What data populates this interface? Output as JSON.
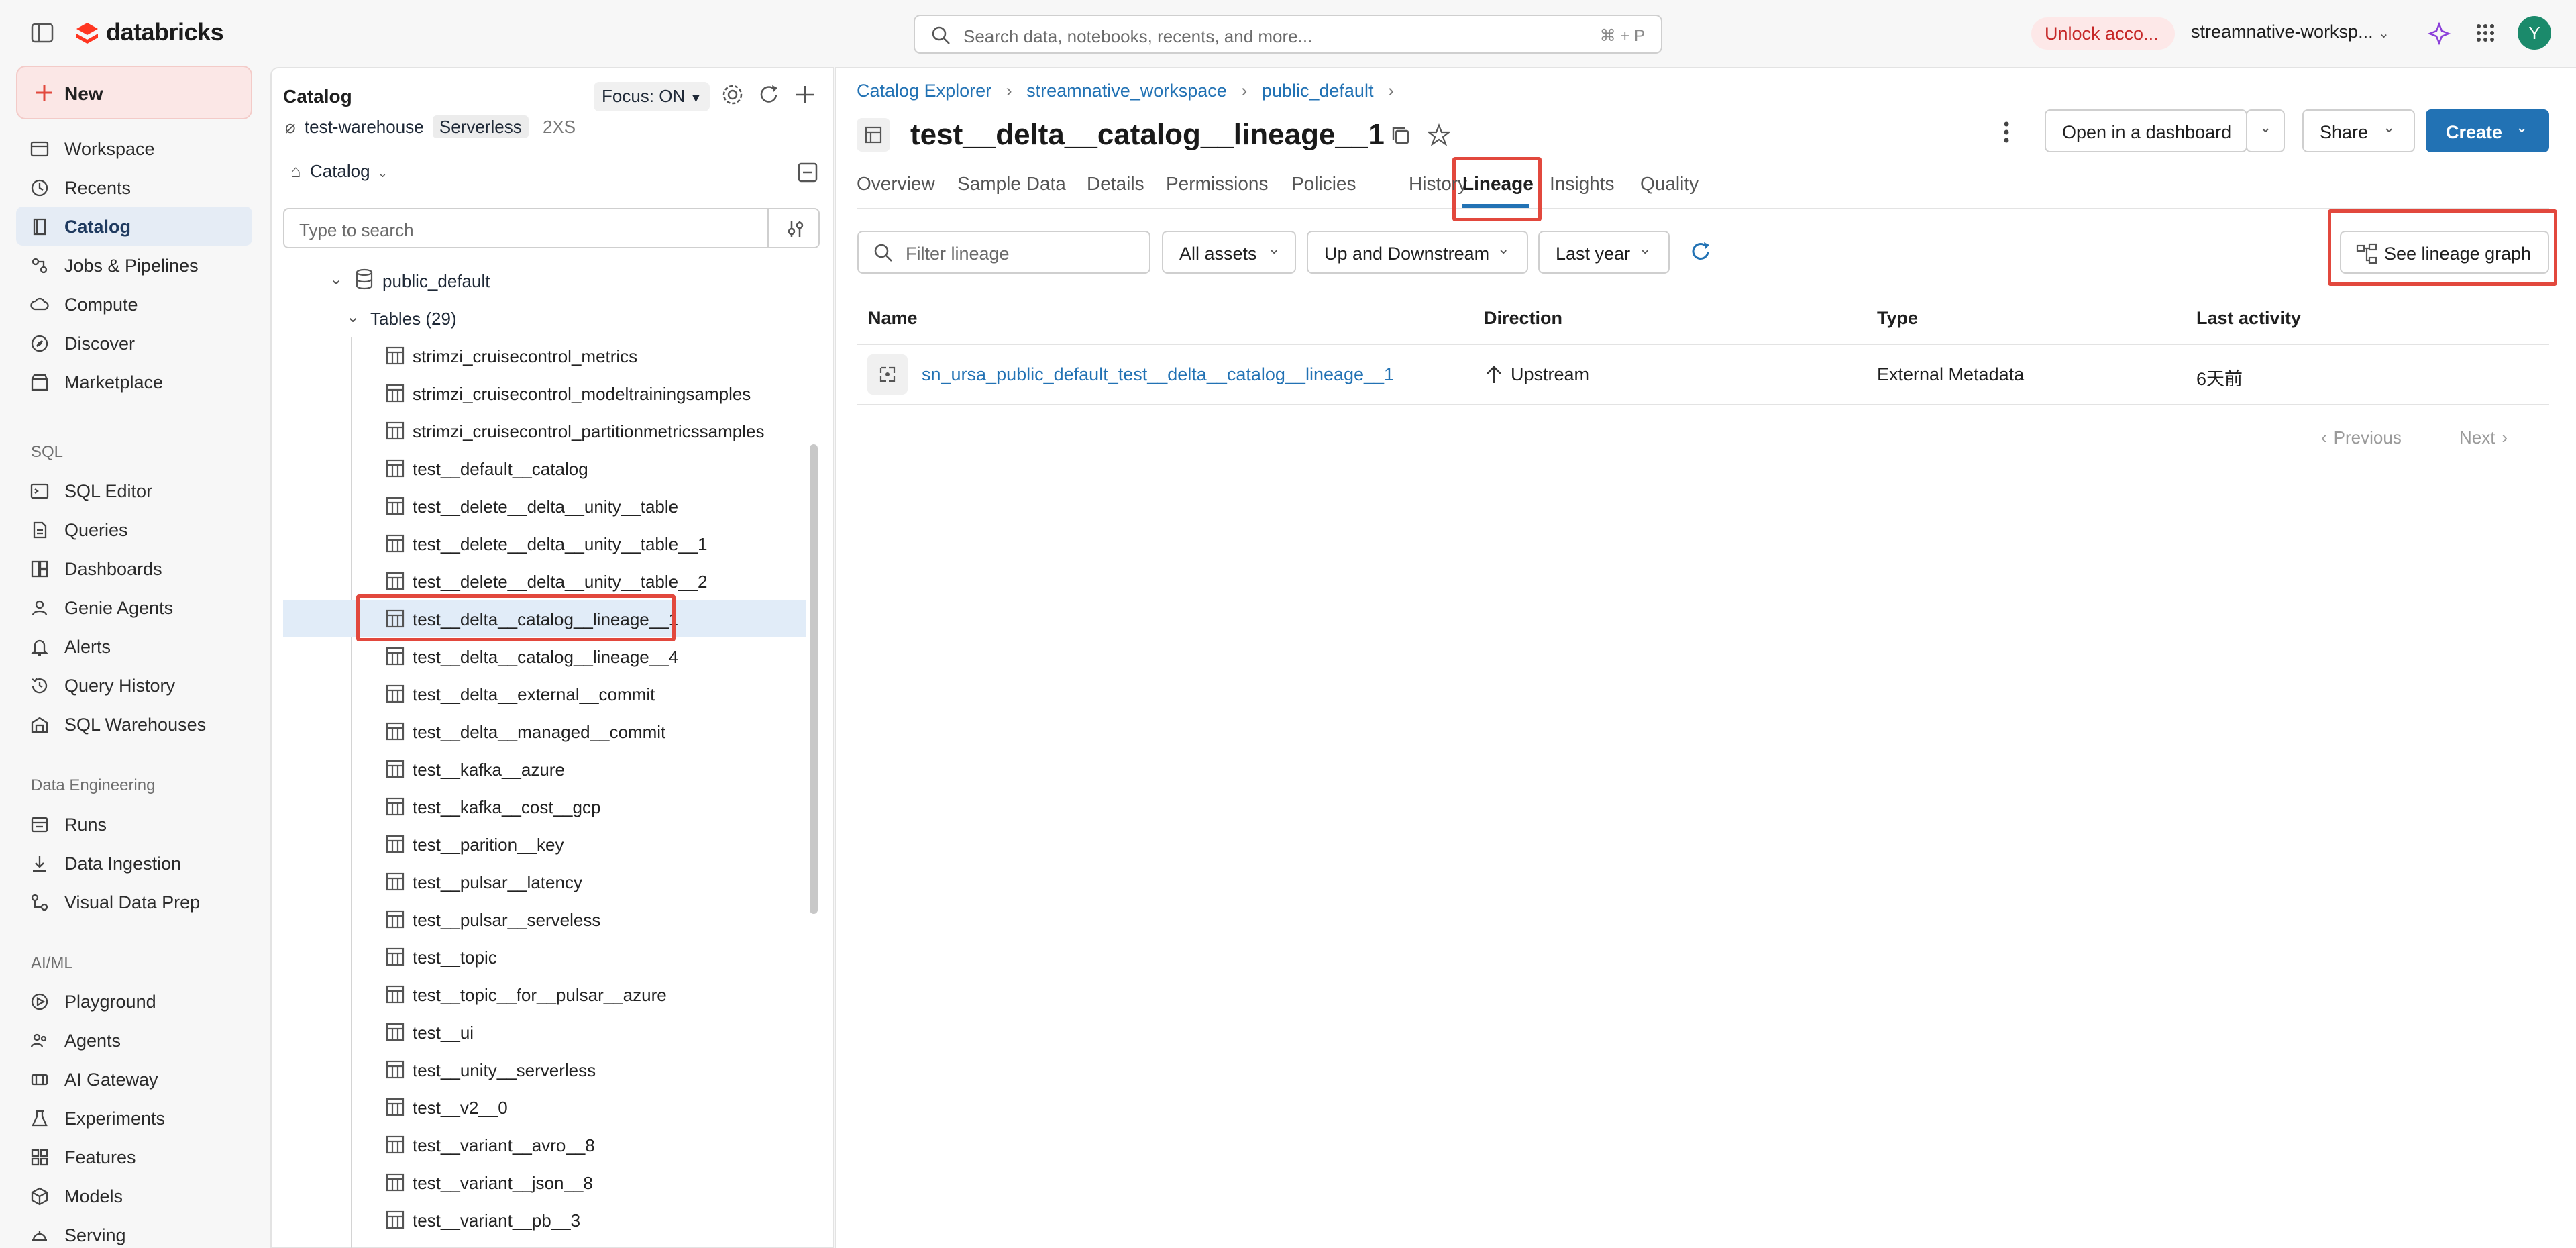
{
  "app": {
    "logo_text": "databricks",
    "search_placeholder": "Search data, notebooks, recents, and more...",
    "search_shortcut": "⌘ + P",
    "unlock_label": "Unlock acco...",
    "workspace_label": "streamnative-worksp...",
    "avatar_initial": "Y"
  },
  "nav": {
    "new_label": "New",
    "items": [
      {
        "label": "Workspace",
        "icon": "workspace-icon"
      },
      {
        "label": "Recents",
        "icon": "clock-icon"
      },
      {
        "label": "Catalog",
        "icon": "catalog-icon",
        "active": true
      },
      {
        "label": "Jobs & Pipelines",
        "icon": "jobs-icon"
      },
      {
        "label": "Compute",
        "icon": "cloud-icon"
      },
      {
        "label": "Discover",
        "icon": "compass-icon"
      },
      {
        "label": "Marketplace",
        "icon": "store-icon"
      }
    ],
    "sql_header": "SQL",
    "sql_items": [
      {
        "label": "SQL Editor",
        "icon": "sql-editor-icon"
      },
      {
        "label": "Queries",
        "icon": "queries-icon"
      },
      {
        "label": "Dashboards",
        "icon": "dashboard-icon"
      },
      {
        "label": "Genie Agents",
        "icon": "genie-icon"
      },
      {
        "label": "Alerts",
        "icon": "bell-icon"
      },
      {
        "label": "Query History",
        "icon": "history-icon"
      },
      {
        "label": "SQL Warehouses",
        "icon": "warehouse-icon"
      }
    ],
    "de_header": "Data Engineering",
    "de_items": [
      {
        "label": "Runs",
        "icon": "runs-icon"
      },
      {
        "label": "Data Ingestion",
        "icon": "ingestion-icon"
      },
      {
        "label": "Visual Data Prep",
        "icon": "data-prep-icon"
      }
    ],
    "ml_header": "AI/ML",
    "ml_items": [
      {
        "label": "Playground",
        "icon": "playground-icon"
      },
      {
        "label": "Agents",
        "icon": "agents-icon"
      },
      {
        "label": "AI Gateway",
        "icon": "gateway-icon"
      },
      {
        "label": "Experiments",
        "icon": "experiments-icon"
      },
      {
        "label": "Features",
        "icon": "features-icon"
      },
      {
        "label": "Models",
        "icon": "models-icon"
      },
      {
        "label": "Serving",
        "icon": "serving-icon"
      }
    ]
  },
  "catalog_panel": {
    "title": "Catalog",
    "focus_label": "Focus: ON",
    "warehouse_name": "test-warehouse",
    "warehouse_type": "Serverless",
    "warehouse_size": "2XS",
    "catalog_dropdown": "Catalog",
    "search_placeholder": "Type to search",
    "schema_name": "public_default",
    "tables_label": "Tables (29)",
    "tables": [
      "strimzi_cruisecontrol_metrics",
      "strimzi_cruisecontrol_modeltrainingsamples",
      "strimzi_cruisecontrol_partitionmetricssamples",
      "test__default__catalog",
      "test__delete__delta__unity__table",
      "test__delete__delta__unity__table__1",
      "test__delete__delta__unity__table__2",
      "test__delta__catalog__lineage__1",
      "test__delta__catalog__lineage__4",
      "test__delta__external__commit",
      "test__delta__managed__commit",
      "test__kafka__azure",
      "test__kafka__cost__gcp",
      "test__parition__key",
      "test__pulsar__latency",
      "test__pulsar__serveless",
      "test__topic",
      "test__topic__for__pulsar__azure",
      "test__ui",
      "test__unity__serverless",
      "test__v2__0",
      "test__variant__avro__8",
      "test__variant__json__8",
      "test__variant__pb__3"
    ],
    "selected_index": 7
  },
  "main": {
    "breadcrumb": [
      "Catalog Explorer",
      "streamnative_workspace",
      "public_default"
    ],
    "title": "test__delta__catalog__lineage__1",
    "open_dashboard_label": "Open in a dashboard",
    "share_label": "Share",
    "create_label": "Create",
    "tabs": [
      "Overview",
      "Sample Data",
      "Details",
      "Permissions",
      "Policies",
      "History",
      "Lineage",
      "Insights",
      "Quality"
    ],
    "active_tab": "Lineage",
    "filter_placeholder": "Filter lineage",
    "filters": [
      "All assets",
      "Up and Downstream",
      "Last year"
    ],
    "see_graph_label": "See lineage graph",
    "columns": [
      "Name",
      "Direction",
      "Type",
      "Last activity"
    ],
    "rows": [
      {
        "name": "sn_ursa_public_default_test__delta__catalog__lineage__1",
        "direction": "Upstream",
        "type": "External Metadata",
        "last_activity": "6天前"
      }
    ],
    "pagination": {
      "previous": "Previous",
      "next": "Next"
    }
  },
  "colors": {
    "accent": "#2272b4",
    "highlight": "#e2483d",
    "create_button": "#2272b4"
  }
}
